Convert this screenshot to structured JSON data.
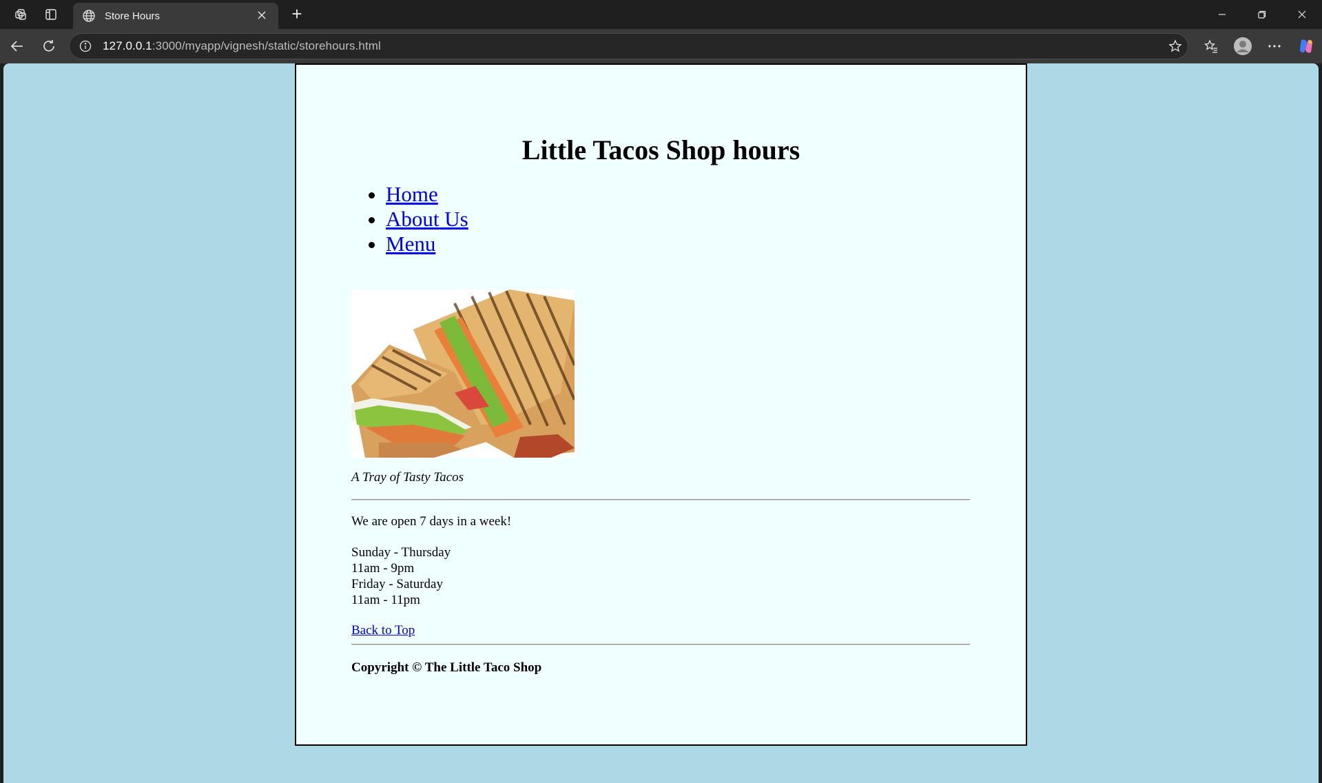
{
  "browser": {
    "tab_title": "Store Hours",
    "url_host": "127.0.0.1",
    "url_rest": ":3000/myapp/vignesh/static/storehours.html",
    "new_tab": "+"
  },
  "page": {
    "title": "Little Tacos Shop hours",
    "nav": [
      "Home",
      "About Us",
      "Menu"
    ],
    "image_caption": "A Tray of Tasty Tacos",
    "open_text": "We are open 7 days in a week!",
    "hours": [
      "Sunday - Thursday",
      "11am - 9pm",
      "Friday - Saturday",
      "11am - 11pm"
    ],
    "back_to_top": "Back to Top",
    "copyright": "Copyright © The Little Taco Shop"
  },
  "colors": {
    "page_bg": "#add8e6",
    "container_bg": "#f0ffff",
    "link": "#0000ee"
  }
}
